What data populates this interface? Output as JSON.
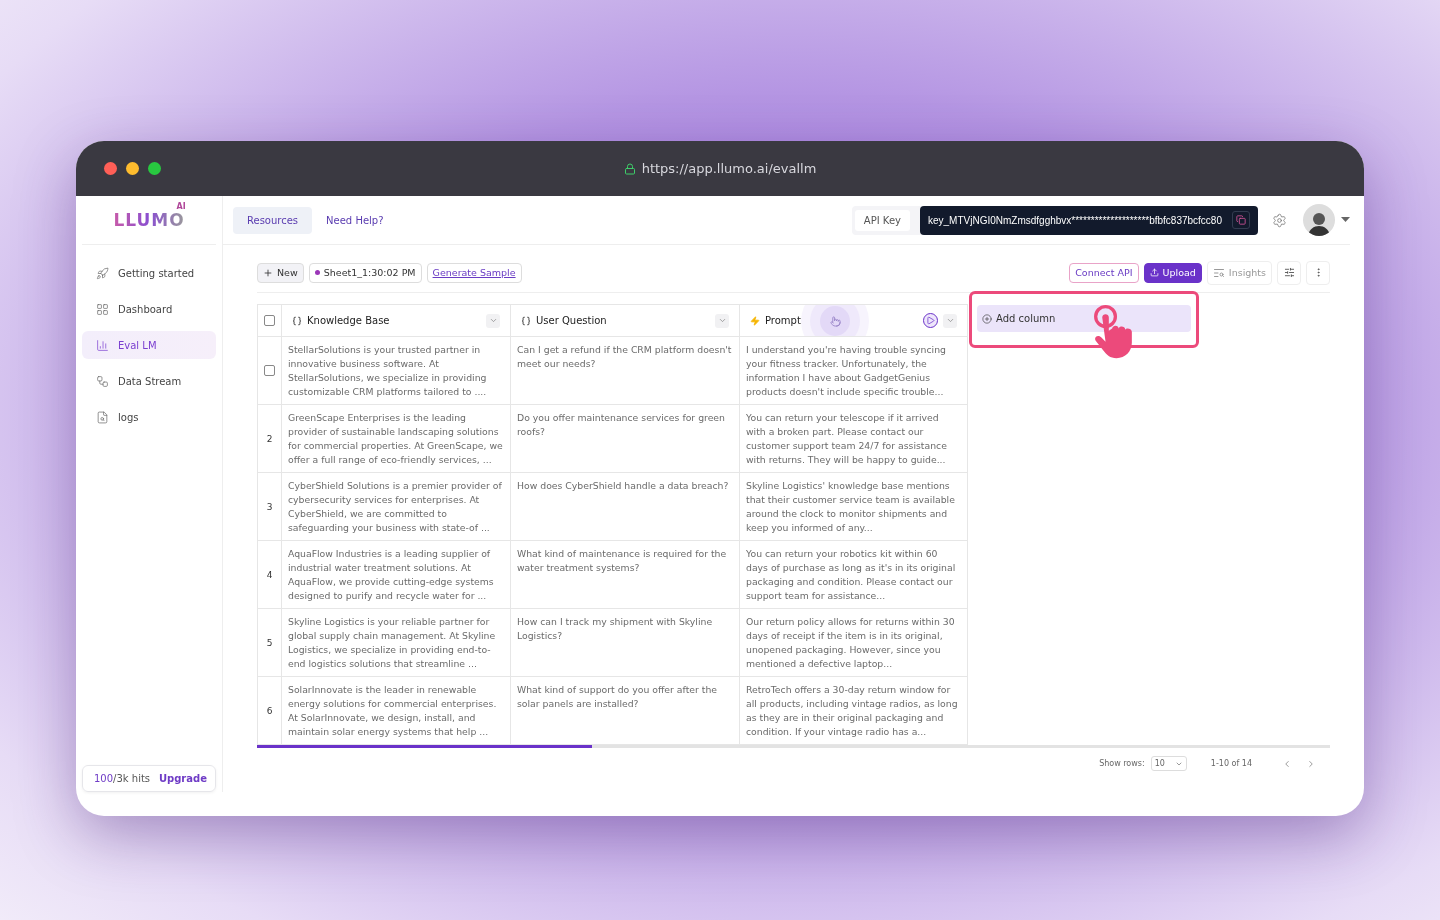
{
  "browser": {
    "url": "https://app.llumo.ai/evallm"
  },
  "logo": {
    "name": "LLUMO",
    "badge": "AI"
  },
  "sidebar": {
    "items": [
      {
        "label": "Getting started",
        "selected": false
      },
      {
        "label": "Dashboard",
        "selected": false
      },
      {
        "label": "Eval LM",
        "selected": true
      },
      {
        "label": "Data Stream",
        "selected": false
      },
      {
        "label": "logs",
        "selected": false
      }
    ],
    "usage": {
      "used": "100",
      "total": "/3k hits",
      "action": "Upgrade"
    }
  },
  "header": {
    "tabs": [
      {
        "label": "Resources",
        "selected": true
      },
      {
        "label": "Need Help?",
        "selected": false
      }
    ],
    "api_key": {
      "label": "API Key",
      "value": "key_MTVjNGI0NmZmsdfgghbvx********************bfbfc837bcfcc80"
    }
  },
  "toolbar": {
    "new": "New",
    "sheet": "Sheet1_1:30:02 PM",
    "generate": "Generate Sample",
    "connect": "Connect API",
    "upload": "Upload",
    "insights": "Insights"
  },
  "table": {
    "select_all": {
      "checked": false
    },
    "columns": [
      {
        "label": "Knowledge Base",
        "kind": "variable"
      },
      {
        "label": "User Question",
        "kind": "variable"
      },
      {
        "label": "Prompt",
        "kind": "prompt"
      }
    ],
    "rows": [
      {
        "kind": "checkbox",
        "checked": false,
        "cells": [
          "StellarSolutions is your trusted partner in innovative business software. At StellarSolutions, we specialize in providing customizable CRM platforms tailored to ....",
          "Can I get a refund if the CRM platform doesn't meet our needs?",
          "I understand you're having trouble syncing your fitness tracker. Unfortunately, the information I have about GadgetGenius products doesn't include specific trouble..."
        ]
      },
      {
        "kind": "number",
        "number": "2",
        "cells": [
          "GreenScape Enterprises is the leading provider of sustainable landscaping solutions for commercial properties. At GreenScape, we offer a full range of eco-friendly services, ...",
          "Do you offer maintenance services for green roofs?",
          "You can return your telescope if it arrived with a broken part. Please contact our customer support team 24/7 for assistance with returns. They will be happy to guide..."
        ]
      },
      {
        "kind": "number",
        "number": "3",
        "cells": [
          "CyberShield Solutions is a premier provider of cybersecurity services for enterprises. At CyberShield, we are committed to safeguarding your business with state-of ...",
          "How does CyberShield handle a data breach?",
          "Skyline Logistics' knowledge base mentions that their customer service team is available around the clock to monitor shipments and keep you informed of any..."
        ]
      },
      {
        "kind": "number",
        "number": "4",
        "cells": [
          "AquaFlow Industries is a leading supplier of industrial water treatment solutions. At AquaFlow, we provide cutting-edge systems designed to purify and recycle water for ...",
          "What kind of maintenance is required for the water treatment systems?",
          "You can return your robotics kit within 60 days of purchase as long as it's in its original packaging and condition. Please contact our support team for assistance..."
        ]
      },
      {
        "kind": "number",
        "number": "5",
        "cells": [
          "Skyline Logistics is your reliable partner for global supply chain management. At Skyline Logistics, we specialize in providing end-to-end logistics solutions that streamline ...",
          "How can I track my shipment with Skyline Logistics?",
          "Our return policy allows for returns within 30 days of receipt if the item is in its original, unopened packaging. However, since you mentioned a defective laptop..."
        ]
      },
      {
        "kind": "number",
        "number": "6",
        "cells": [
          "SolarInnovate is the leader in renewable energy solutions for commercial enterprises. At SolarInnovate, we design, install, and maintain solar energy systems that help ...",
          "What kind of support do you offer after the solar panels are installed?",
          "RetroTech offers a 30-day return window for all products, including vintage radios, as long as they are in their original packaging and condition. If your vintage radio has a..."
        ]
      }
    ],
    "add_column": "Add column"
  },
  "pagination": {
    "label": "Show rows:",
    "rows": "10",
    "range": "1-10 of 14"
  }
}
